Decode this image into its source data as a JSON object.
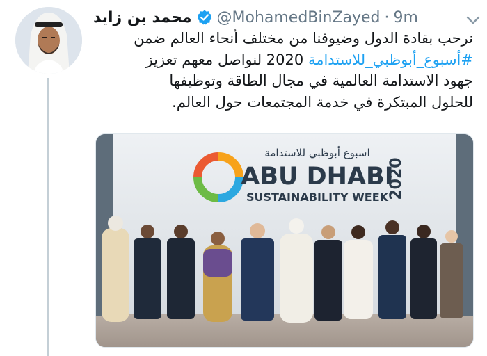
{
  "author": {
    "display_name": "محمد بن زايد",
    "handle": "@MohamedBinZayed",
    "separator": "·",
    "time": "9m",
    "verified": true
  },
  "tweet": {
    "line1": "نرحب بقادة الدول وضيوفنا من مختلف أنحاء العالم ضمن",
    "hashtag": "#أسبوع_أبوظبي_للاستدامة",
    "line2_rest": " 2020 لنواصل معهم تعزيز",
    "line3": "جهود الاستدامة العالمية في مجال الطاقة وتوظيفها",
    "line4": "للحلول المبتكرة في خدمة المجتمعات حول العالم."
  },
  "media": {
    "banner_arabic": "اسبوع أبوظبي للاستدامة",
    "banner_title": "ABU DHABI",
    "banner_subtitle": "SUSTAINABILITY WEEK",
    "banner_year": "2020",
    "logo_colors": [
      "#f7a21b",
      "#2ca8e0",
      "#6dbb45",
      "#eb5a32"
    ]
  },
  "icons": {
    "verified": "verified-badge-icon",
    "caret": "chevron-down-icon"
  },
  "colors": {
    "link": "#1da1f2",
    "secondary_text": "#657786",
    "thread_line": "#c4cfd6"
  }
}
